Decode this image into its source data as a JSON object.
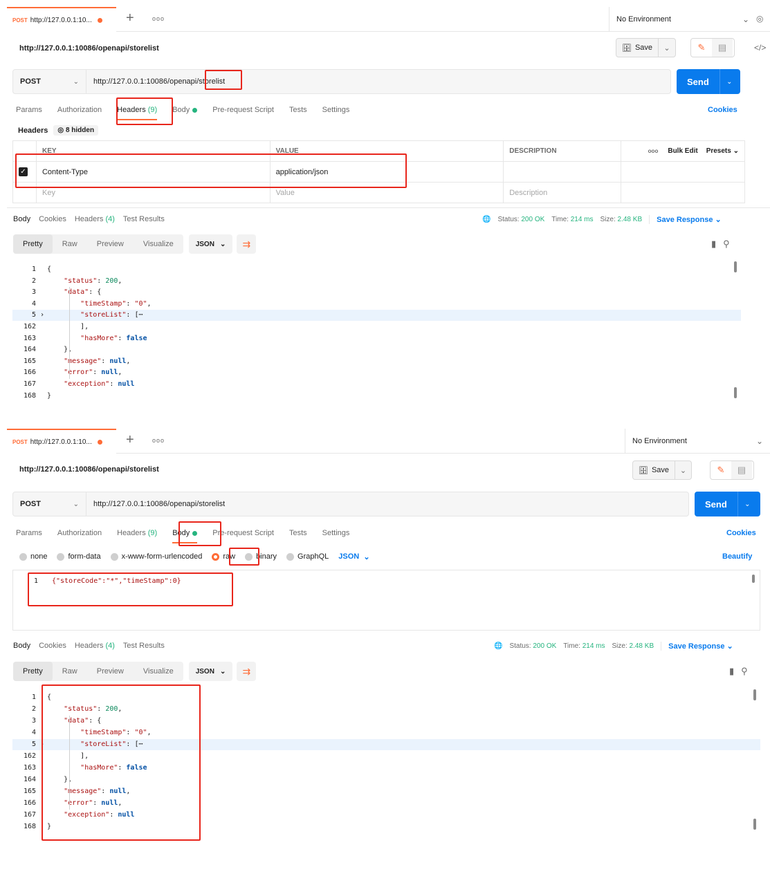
{
  "tab": {
    "method": "POST",
    "url": "http://127.0.0.1:10...",
    "plus": "+",
    "more": "ooo"
  },
  "environment": {
    "label": "No Environment"
  },
  "request": {
    "title": "http://127.0.0.1:10086/openapi/storelist",
    "method": "POST",
    "url": "http://127.0.0.1:10086/openapi/storelist",
    "save_label": "Save",
    "send_label": "Send"
  },
  "req_tabs": {
    "params": "Params",
    "authorization": "Authorization",
    "headers": "Headers",
    "headers_count": "(9)",
    "body": "Body",
    "prerequest": "Pre-request Script",
    "tests": "Tests",
    "settings": "Settings",
    "cookies": "Cookies"
  },
  "headers_section": {
    "label": "Headers",
    "hidden": "8 hidden",
    "columns": {
      "key": "KEY",
      "value": "VALUE",
      "description": "DESCRIPTION",
      "more": "ooo",
      "bulk_edit": "Bulk Edit",
      "presets": "Presets"
    },
    "rows": [
      {
        "key": "Content-Type",
        "value": "application/json",
        "checked": true
      }
    ],
    "placeholder": {
      "key": "Key",
      "value": "Value",
      "description": "Description"
    }
  },
  "body_options": {
    "none": "none",
    "form_data": "form-data",
    "urlencoded": "x-www-form-urlencoded",
    "raw": "raw",
    "binary": "binary",
    "graphql": "GraphQL",
    "format": "JSON",
    "beautify": "Beautify"
  },
  "request_body": {
    "line": "1",
    "text": "{\"storeCode\":\"*\",\"timeStamp\":0}"
  },
  "response": {
    "tabs": {
      "body": "Body",
      "cookies": "Cookies",
      "headers": "Headers",
      "headers_count": "(4)",
      "test_results": "Test Results"
    },
    "status_label": "Status:",
    "status_value": "200 OK",
    "time_label": "Time:",
    "time_value": "214 ms",
    "size_label": "Size:",
    "size_value": "2.48 KB",
    "save_response": "Save Response",
    "view_modes": {
      "pretty": "Pretty",
      "raw": "Raw",
      "preview": "Preview",
      "visualize": "Visualize"
    },
    "format": "JSON"
  },
  "response_lines": [
    {
      "n": "1",
      "html": "{"
    },
    {
      "n": "2",
      "html": "    \"status\": 200,"
    },
    {
      "n": "3",
      "html": "    \"data\": {"
    },
    {
      "n": "4",
      "html": "        \"timeStamp\": \"0\","
    },
    {
      "n": "5",
      "html": "        \"storeList\": [⋯"
    },
    {
      "n": "162",
      "html": "        ],"
    },
    {
      "n": "163",
      "html": "        \"hasMore\": false"
    },
    {
      "n": "164",
      "html": "    },"
    },
    {
      "n": "165",
      "html": "    \"message\": null,"
    },
    {
      "n": "166",
      "html": "    \"error\": null,"
    },
    {
      "n": "167",
      "html": "    \"exception\": null"
    },
    {
      "n": "168",
      "html": "}"
    }
  ],
  "colors": {
    "accent": "#ff6c37",
    "send": "#097bed",
    "status": "#26b47f",
    "annotation": "#e8261c"
  }
}
